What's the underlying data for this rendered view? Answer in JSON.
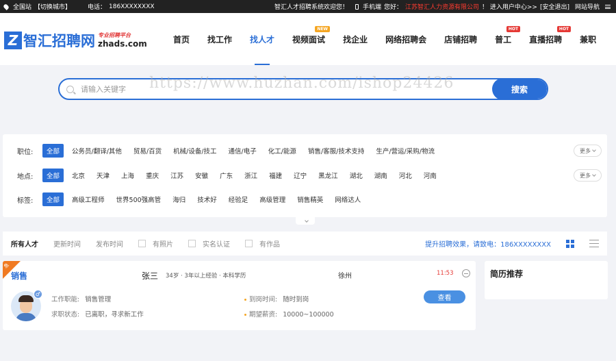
{
  "topbar": {
    "site": "全国站",
    "switch_city": "【切换城市】",
    "phone_label": "电话：",
    "phone": "186XXXXXXXX",
    "welcome": "智汇人才招聘系统欢迎您！",
    "mobile": "手机端",
    "hello": "您好：",
    "company": "江苏智汇人力资源有限公司",
    "user_center": "！ 进入用户中心>>",
    "logout": "[安全退出]",
    "site_nav": "网站导航"
  },
  "logo": {
    "mark": "Z",
    "name": "智汇招聘网",
    "slogan": "专业招聘平台",
    "domain": "zhads.com"
  },
  "nav": [
    {
      "label": "首页"
    },
    {
      "label": "找工作"
    },
    {
      "label": "找人才",
      "active": true
    },
    {
      "label": "视频面试",
      "badge": "NEW"
    },
    {
      "label": "找企业"
    },
    {
      "label": "网络招聘会"
    },
    {
      "label": "店铺招聘"
    },
    {
      "label": "普工",
      "badge": "HOT"
    },
    {
      "label": "直播招聘",
      "badge": "HOT"
    },
    {
      "label": "兼职"
    }
  ],
  "search": {
    "placeholder": "请输入关键字",
    "button": "搜索",
    "watermark": "https://www.huzhan.com/ishop24426"
  },
  "filters": {
    "more": "更多",
    "rows": [
      {
        "label": "职位:",
        "options": [
          "全部",
          "公务员/翻译/其他",
          "贸易/百货",
          "机械/设备/技工",
          "通信/电子",
          "化工/能源",
          "销售/客服/技术支持",
          "生产/营运/采购/物流"
        ],
        "has_more": true
      },
      {
        "label": "地点:",
        "options": [
          "全部",
          "北京",
          "天津",
          "上海",
          "重庆",
          "江苏",
          "安徽",
          "广东",
          "浙江",
          "福建",
          "辽宁",
          "黑龙江",
          "湖北",
          "湖南",
          "河北",
          "河南"
        ],
        "has_more": true
      },
      {
        "label": "标签:",
        "options": [
          "全部",
          "高级工程师",
          "世界500强高管",
          "海归",
          "技术好",
          "经验足",
          "高级管理",
          "销售精英",
          "网络达人"
        ],
        "has_more": false
      }
    ]
  },
  "sortbar": {
    "all": "所有人才",
    "update_time": "更新时间",
    "publish_time": "发布时间",
    "has_photo": "有照片",
    "verified": "实名认证",
    "has_works": "有作品",
    "promo": "提升招聘效果，请致电：186XXXXXXXX"
  },
  "resume": {
    "ribbon": "急",
    "job": "销售",
    "name": "张三",
    "meta": "34岁 · 3年以上经验 · 本科学历",
    "city": "徐州",
    "time": "11:53",
    "gender": "♂",
    "function_label": "工作职能:",
    "function_value": "销售管理",
    "status_label": "求职状态:",
    "status_value": "已离职，寻求新工作",
    "arrival_label": "到岗时间:",
    "arrival_value": "随时到岗",
    "salary_label": "期望薪资:",
    "salary_value": "10000~100000",
    "view_button": "查看"
  },
  "side": {
    "title": "简历推荐"
  }
}
